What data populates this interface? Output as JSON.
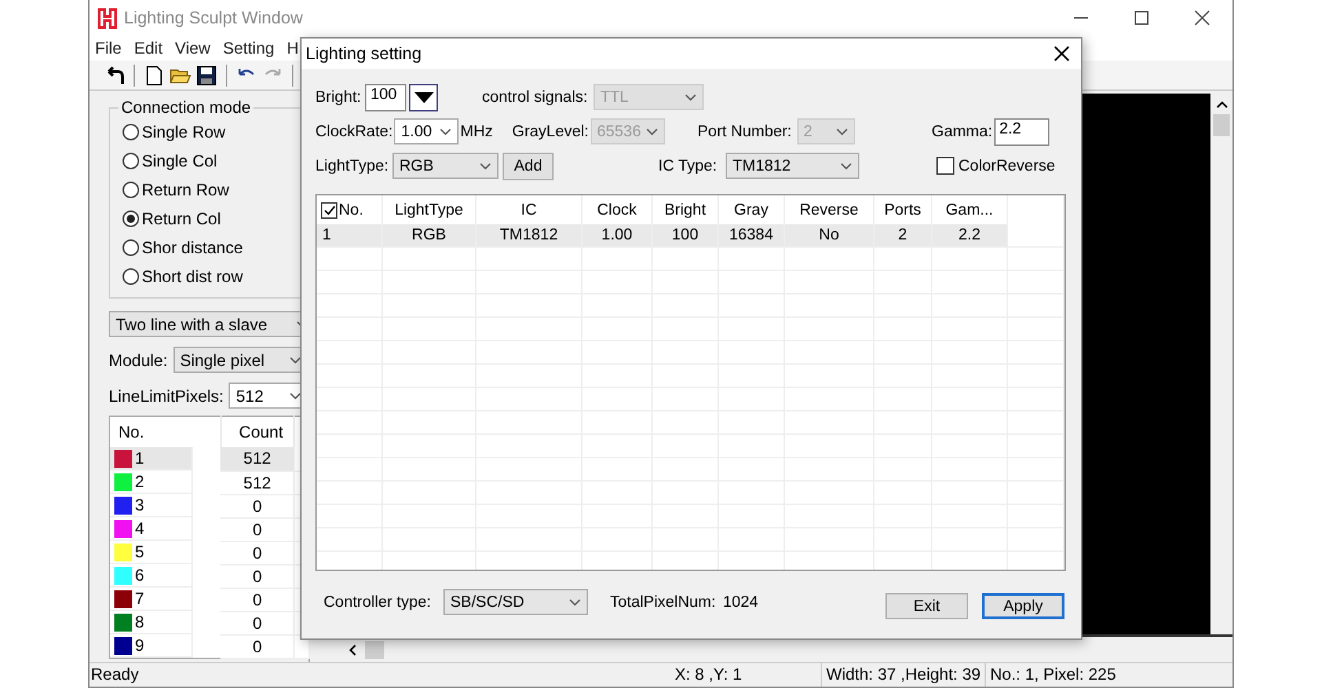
{
  "main_window": {
    "title": "Lighting Sculpt Window",
    "menu": [
      "File",
      "Edit",
      "View",
      "Setting",
      "H"
    ],
    "connection_mode": {
      "title": "Connection mode",
      "options": [
        {
          "label": "Single Row",
          "selected": false
        },
        {
          "label": "Single Col",
          "selected": false
        },
        {
          "label": "Return Row",
          "selected": false
        },
        {
          "label": "Return Col",
          "selected": true
        },
        {
          "label": "Shor distance",
          "selected": false
        },
        {
          "label": "Short dist row",
          "selected": false
        }
      ]
    },
    "wiring": {
      "value": "Two line with a slave"
    },
    "module": {
      "label": "Module:",
      "value": "Single pixel"
    },
    "line_limit": {
      "label": "LineLimitPixels:",
      "value": "512"
    },
    "port_table": {
      "columns": [
        "No.",
        "Count"
      ],
      "rows": [
        {
          "no": "1",
          "count": "512",
          "color": "#c8143c",
          "selected": true
        },
        {
          "no": "2",
          "count": "512",
          "color": "#10f040",
          "selected": false
        },
        {
          "no": "3",
          "count": "0",
          "color": "#2020f0",
          "selected": false
        },
        {
          "no": "4",
          "count": "0",
          "color": "#f010f0",
          "selected": false
        },
        {
          "no": "5",
          "count": "0",
          "color": "#ffff40",
          "selected": false
        },
        {
          "no": "6",
          "count": "0",
          "color": "#30ffff",
          "selected": false
        },
        {
          "no": "7",
          "count": "0",
          "color": "#8c0008",
          "selected": false
        },
        {
          "no": "8",
          "count": "0",
          "color": "#008020",
          "selected": false
        },
        {
          "no": "9",
          "count": "0",
          "color": "#000090",
          "selected": false
        }
      ]
    },
    "status_bar": [
      "Ready",
      "X: 8 ,Y: 1",
      "Width: 37 ,Height: 39",
      "No.: 1, Pixel: 225"
    ]
  },
  "dialog": {
    "title": "Lighting setting",
    "bright": {
      "label": "Bright:",
      "value": "100"
    },
    "control_signals": {
      "label": "control signals:",
      "value": "TTL",
      "disabled": true
    },
    "clock_rate": {
      "label": "ClockRate:",
      "value": "1.00",
      "unit": "MHz",
      "disabled": false
    },
    "gray_level": {
      "label": "GrayLevel:",
      "value": "65536",
      "disabled": true
    },
    "port_number": {
      "label": "Port Number:",
      "value": "2",
      "disabled": true
    },
    "gamma": {
      "label": "Gamma:",
      "value": "2.2"
    },
    "light_type": {
      "label": "LightType:",
      "value": "RGB",
      "disabled": false
    },
    "add_button": "Add",
    "ic_type": {
      "label": "IC Type:",
      "value": "TM1812",
      "disabled": false
    },
    "color_reverse": {
      "label": "ColorReverse",
      "checked": false
    },
    "table": {
      "select_all_checked": true,
      "columns": [
        "No.",
        "LightType",
        "IC",
        "Clock",
        "Bright",
        "Gray",
        "Reverse",
        "Ports",
        "Gam..."
      ],
      "rows": [
        {
          "cells": [
            "1",
            "RGB",
            "TM1812",
            "1.00",
            "100",
            "16384",
            "No",
            "2",
            "2.2"
          ],
          "selected": true
        }
      ]
    },
    "controller_type": {
      "label": "Controller type:",
      "value": "SB/SC/SD",
      "disabled": false
    },
    "total_pixel": {
      "label": "TotalPixelNum:",
      "value": "1024"
    },
    "buttons": [
      {
        "label": "Exit",
        "default": false
      },
      {
        "label": "Apply",
        "default": true
      }
    ]
  }
}
